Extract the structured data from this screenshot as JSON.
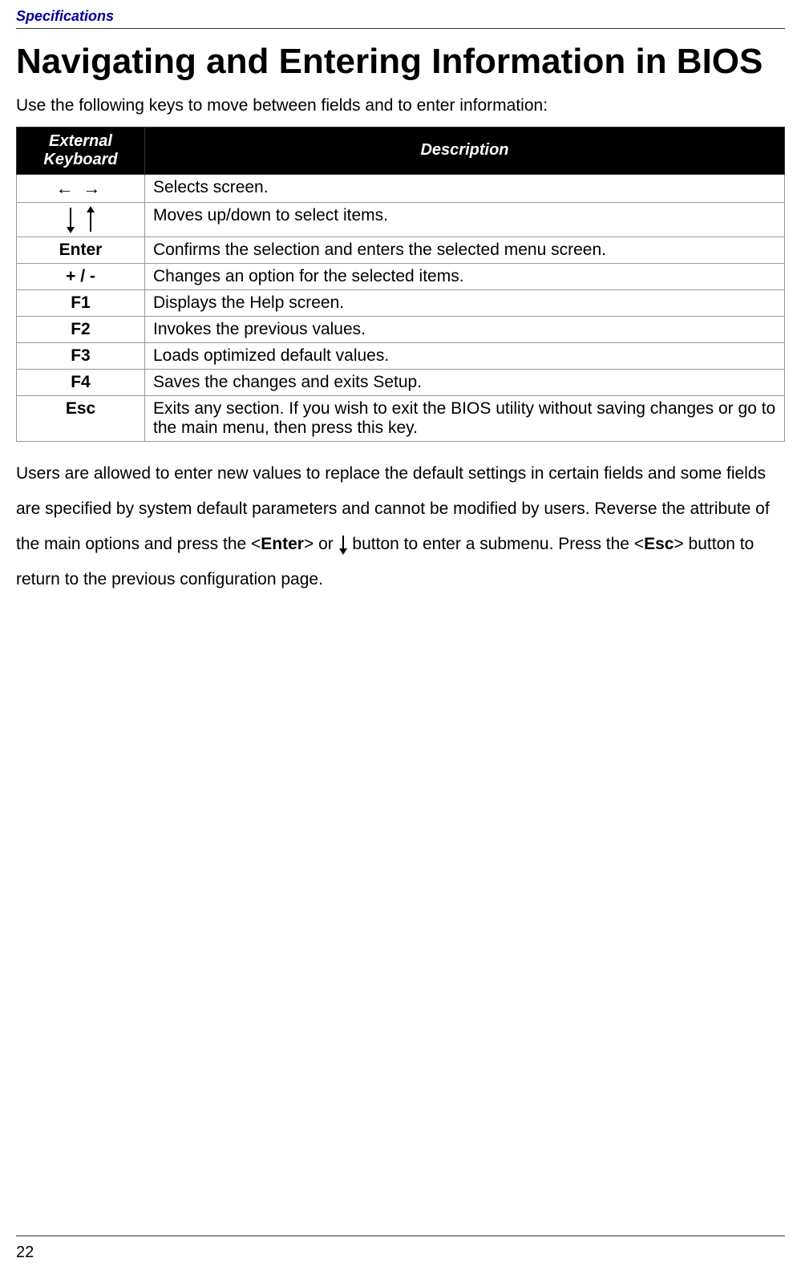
{
  "header": {
    "section": "Specifications"
  },
  "title": "Navigating and Entering Information in BIOS",
  "intro": "Use the following keys to move between fields and to enter information:",
  "table": {
    "headers": {
      "keyboard": "External Keyboard",
      "description": "Description"
    },
    "rows": [
      {
        "key_type": "left-right-arrows",
        "description": "Selects screen."
      },
      {
        "key_type": "up-down-arrows",
        "description": "Moves up/down to select items."
      },
      {
        "key": "Enter",
        "description": "Confirms the selection and enters the selected menu screen."
      },
      {
        "key": "+ / -",
        "description": "Changes an option for the selected items."
      },
      {
        "key": "F1",
        "description": "Displays the Help screen."
      },
      {
        "key": "F2",
        "description": "Invokes the previous values."
      },
      {
        "key": "F3",
        "description": "Loads optimized default values."
      },
      {
        "key": "F4",
        "description": "Saves the changes and exits Setup."
      },
      {
        "key": "Esc",
        "description": "Exits any section. If you wish to exit the BIOS utility without saving changes or go to the main menu, then press this key."
      }
    ]
  },
  "body": {
    "part1": "Users are allowed to enter new values to replace the default settings in certain fields and some fields are specified by system default parameters and cannot be modified by users. Reverse the attribute of the main options and press the <",
    "enter_key": "Enter",
    "part2": "> or ",
    "part3": " button to enter a submenu. Press the <",
    "esc_key": "Esc",
    "part4": "> button to return to the previous configuration page."
  },
  "page_number": "22"
}
